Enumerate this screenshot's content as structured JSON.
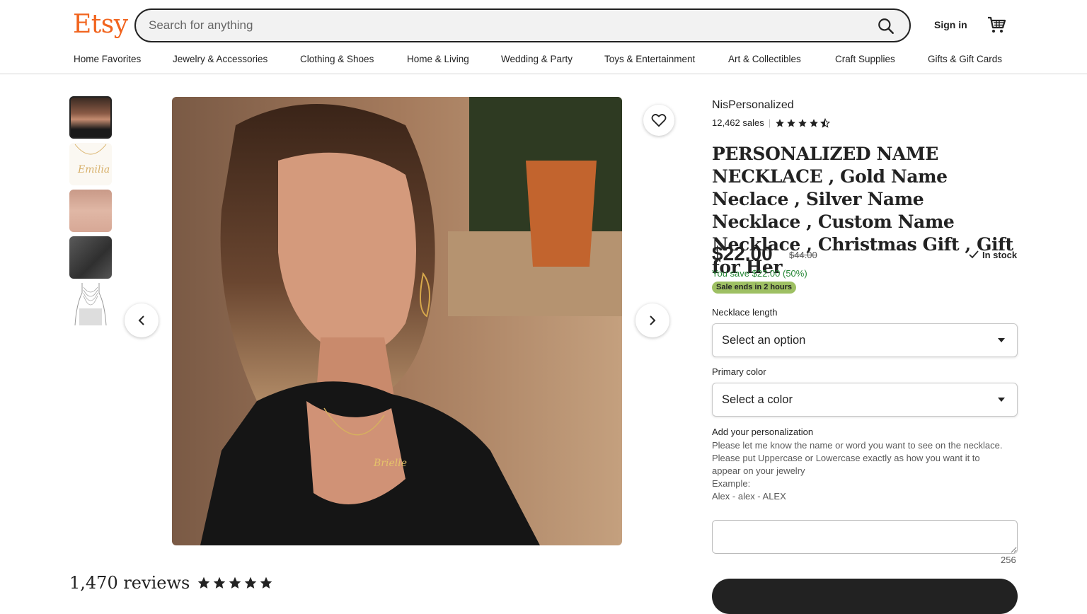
{
  "header": {
    "logo": "Etsy",
    "search_placeholder": "Search for anything",
    "sign_in": "Sign in"
  },
  "nav": [
    "Home Favorites",
    "Jewelry & Accessories",
    "Clothing & Shoes",
    "Home & Living",
    "Wedding & Party",
    "Toys & Entertainment",
    "Art & Collectibles",
    "Craft Supplies",
    "Gifts & Gift Cards"
  ],
  "product": {
    "shop": "NisPersonalized",
    "sales": "12,462 sales",
    "rating": 4.5,
    "title": "PERSONALIZED NAME NECKLACE , Gold Name Neclace , Silver Name Necklace , Custom Name Necklace , Christmas Gift , Gift for Her",
    "price": "$22.00",
    "old_price": "$44.00",
    "in_stock": "In stock",
    "you_save": "You save $22.00 (50%)",
    "sale_ends": "Sale ends in 2 hours",
    "length_label": "Necklace length",
    "length_value": "Select an option",
    "color_label": "Primary color",
    "color_value": "Select a color",
    "personalization_label": "Add your personalization",
    "personalization_lines": [
      "Please let me know the name or word you want to see on the necklace.",
      "Please put Uppercase or Lowercase exactly as how you want it to appear on your jewelry",
      "Example:",
      "Alex - alex - ALEX"
    ],
    "char_count": "256"
  },
  "reviews": {
    "heading": "1,470 reviews"
  },
  "colors": {
    "brand": "#f1641e",
    "sale_green": "#258635",
    "sale_badge": "#9ec063"
  }
}
